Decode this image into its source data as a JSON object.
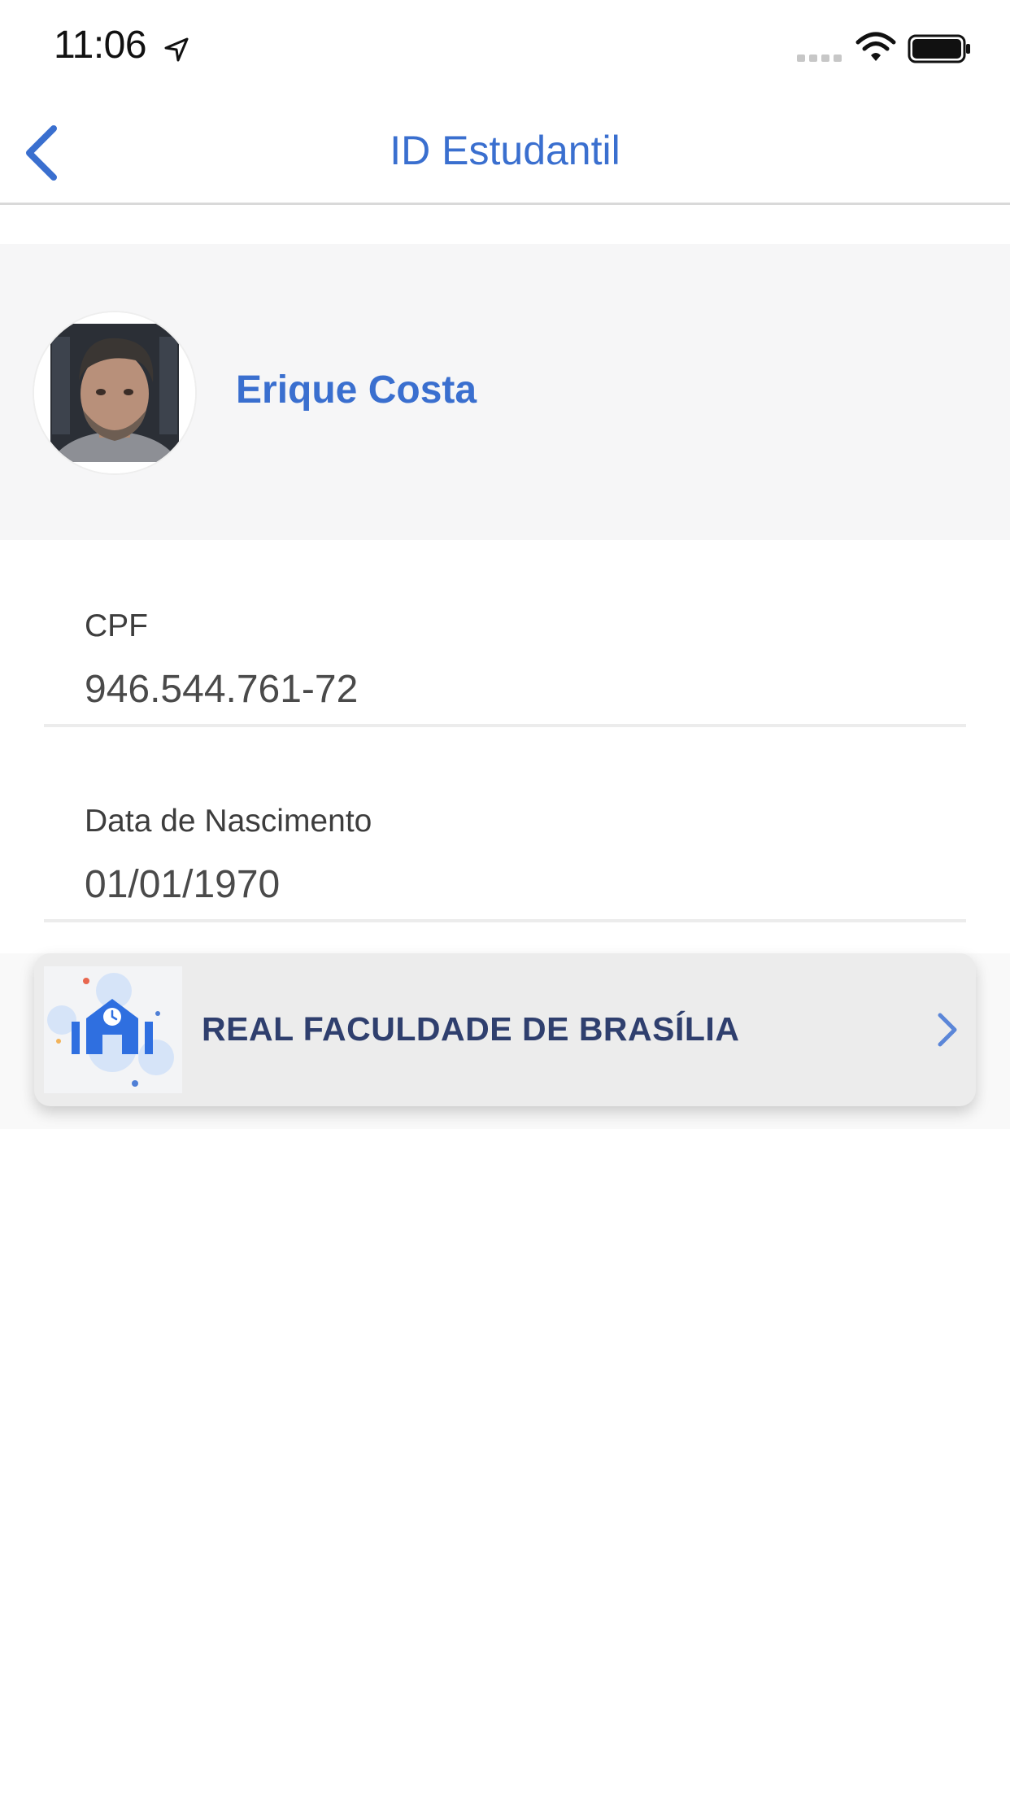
{
  "status_bar": {
    "time": "11:06"
  },
  "nav": {
    "title": "ID Estudantil",
    "back_icon": "chevron-left-icon"
  },
  "profile": {
    "name": "Erique Costa",
    "avatar": "user-photo"
  },
  "fields": [
    {
      "label": "CPF",
      "value": "946.544.761-72"
    },
    {
      "label": "Data de Nascimento",
      "value": "01/01/1970"
    }
  ],
  "institution": {
    "name": "REAL FACULDADE DE BRASÍLIA",
    "logo_icon": "school-building-icon"
  },
  "colors": {
    "accent": "#3a6fcf",
    "institution_text": "#2f3f6e",
    "panel_bg": "#f6f6f7"
  }
}
